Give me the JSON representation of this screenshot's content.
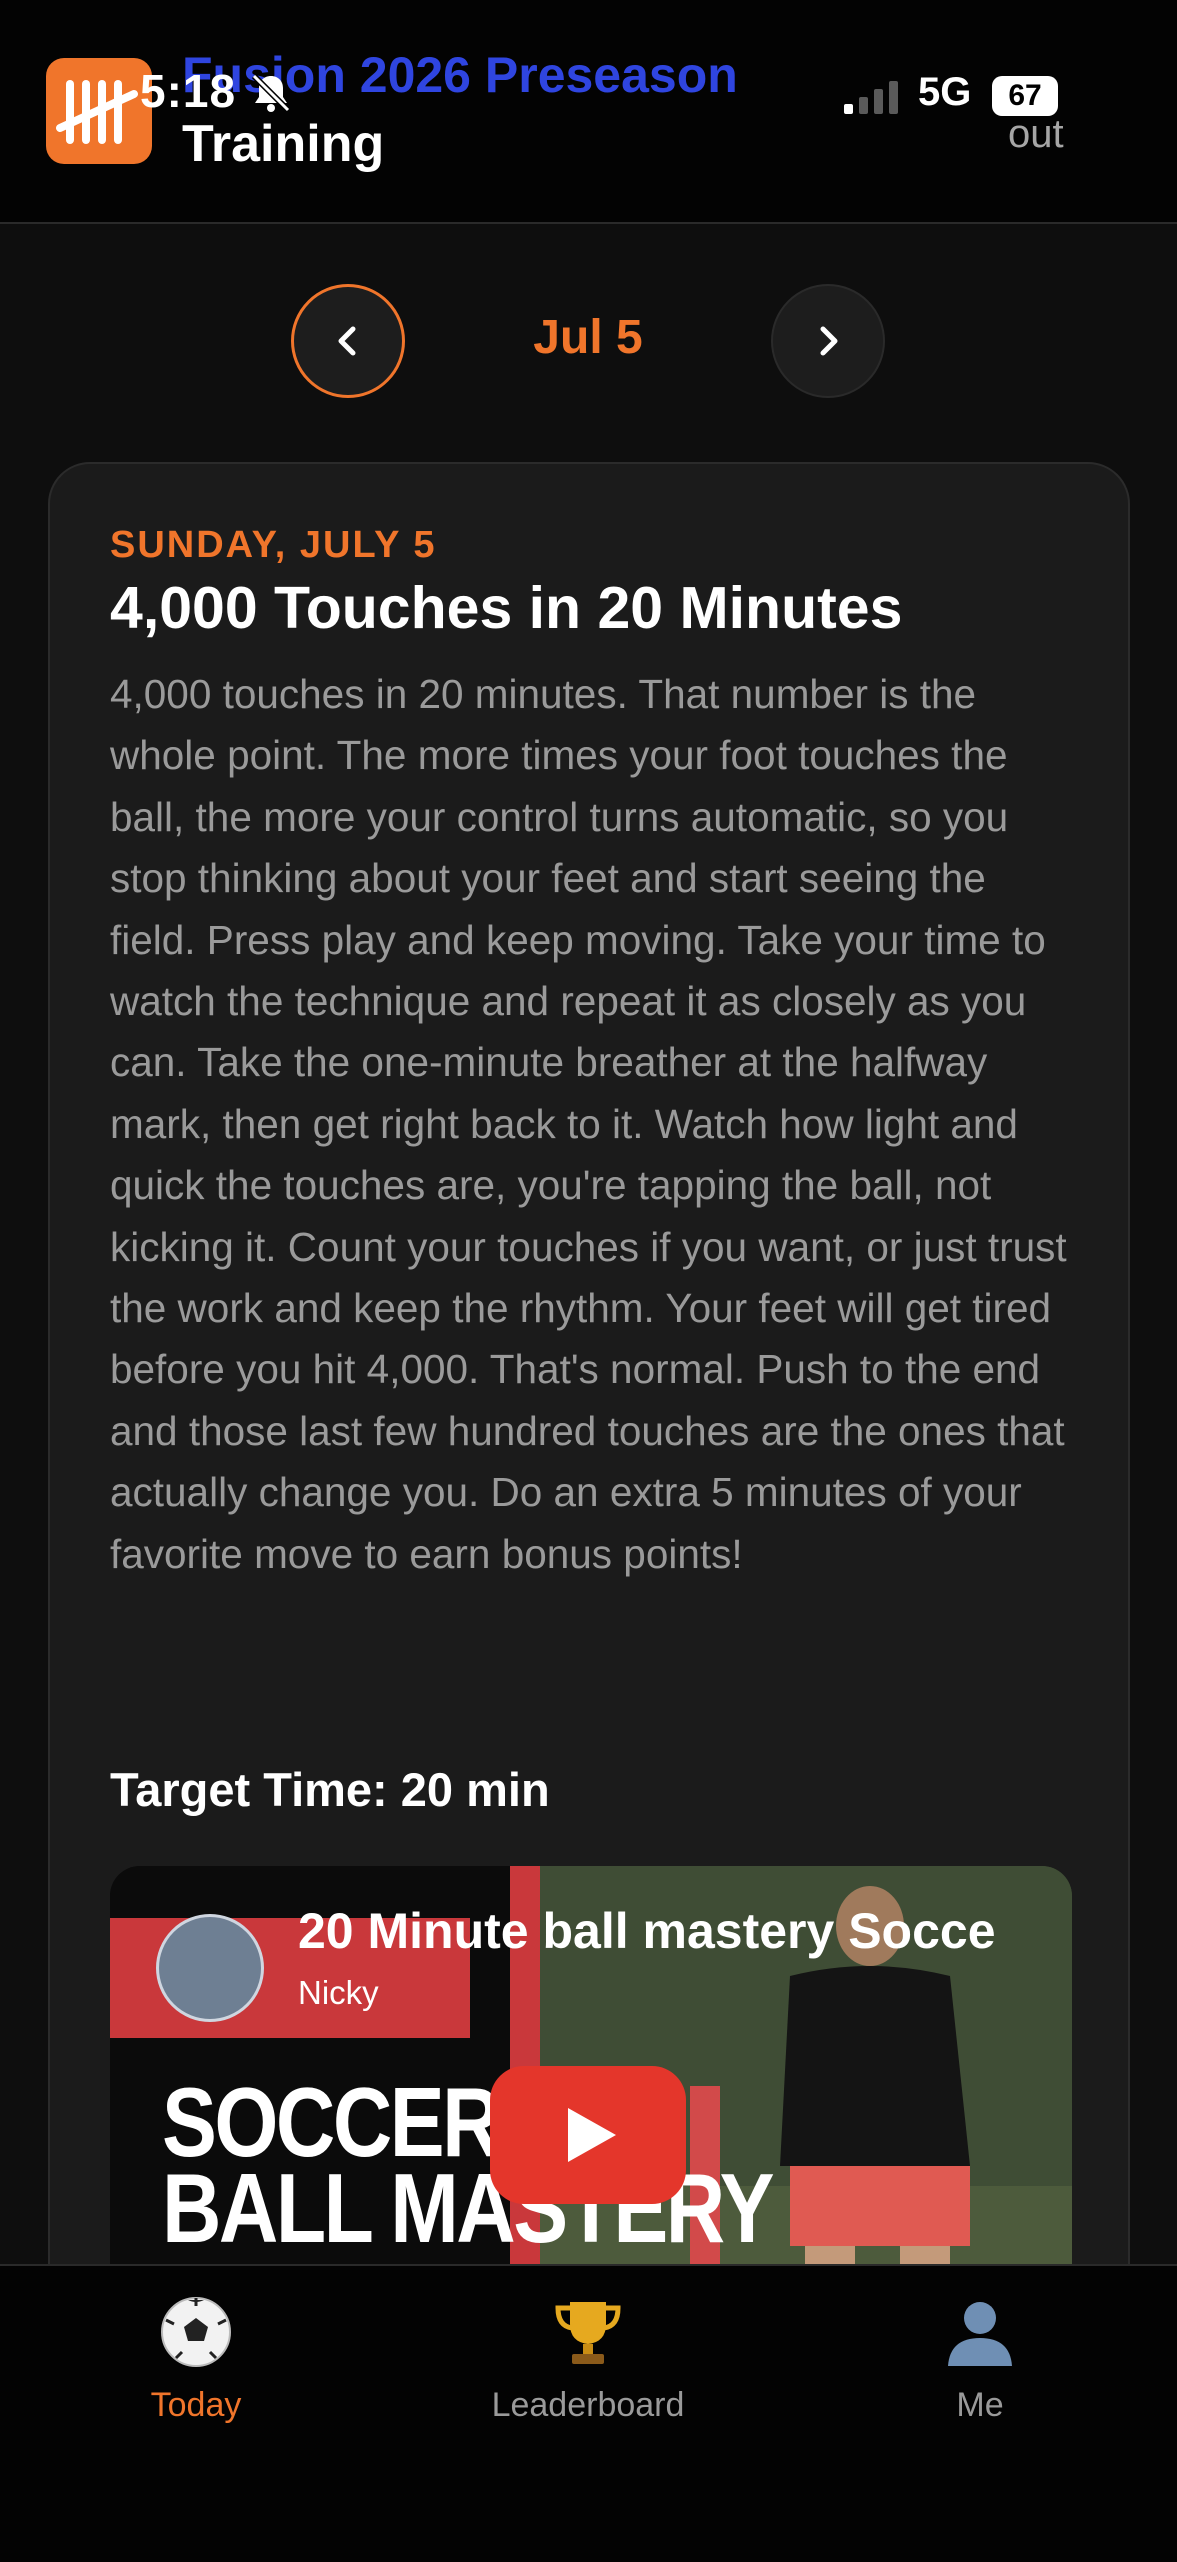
{
  "status_bar": {
    "time": "5:18",
    "network": "5G",
    "battery": "67"
  },
  "header": {
    "title_line1": "Fusion 2026 Preseason",
    "title_line2": "Training",
    "logout": "out"
  },
  "date_nav": {
    "prev_label": "‹",
    "current_date": "Jul 5",
    "next_label": "›"
  },
  "card": {
    "day": "SUNDAY, JULY 5",
    "title": "4,000 Touches in 20 Minutes",
    "description": "4,000 touches in 20 minutes. That number is the whole point. The more times your foot touches the ball, the more your control turns automatic, so you stop thinking about your feet and start seeing the field. Press play and keep moving. Take your time to watch the technique and repeat it as closely as you can. Take the one-minute breather at the halfway mark, then get right back to it. Watch how light and quick the touches are, you're tapping the ball, not kicking it. Count your touches if you want, or just trust the work and keep the rhythm. Your feet will get tired before you hit 4,000. That's normal. Push to the end and those last few hundred touches are the ones that actually change you. Do an extra 5 minutes of your favorite move to earn bonus points!",
    "target_time": "Target Time: 20 min"
  },
  "video": {
    "title": "20 Minute ball mastery Socce",
    "channel": "Nicky",
    "thumb_text_line1": "SOCCER",
    "thumb_text_line2": "BALL MASTERY"
  },
  "tabbar": {
    "items": [
      {
        "label": "Today",
        "icon": "soccer-ball-icon",
        "active": true
      },
      {
        "label": "Leaderboard",
        "icon": "trophy-icon",
        "active": false
      },
      {
        "label": "Me",
        "icon": "user-silhouette-icon",
        "active": false
      }
    ]
  },
  "colors": {
    "accent": "#f0752b",
    "title_blue": "#2f45e0",
    "background": "#0e0e0e",
    "card": "#1b1b1b",
    "youtube_red": "#e4362b"
  }
}
